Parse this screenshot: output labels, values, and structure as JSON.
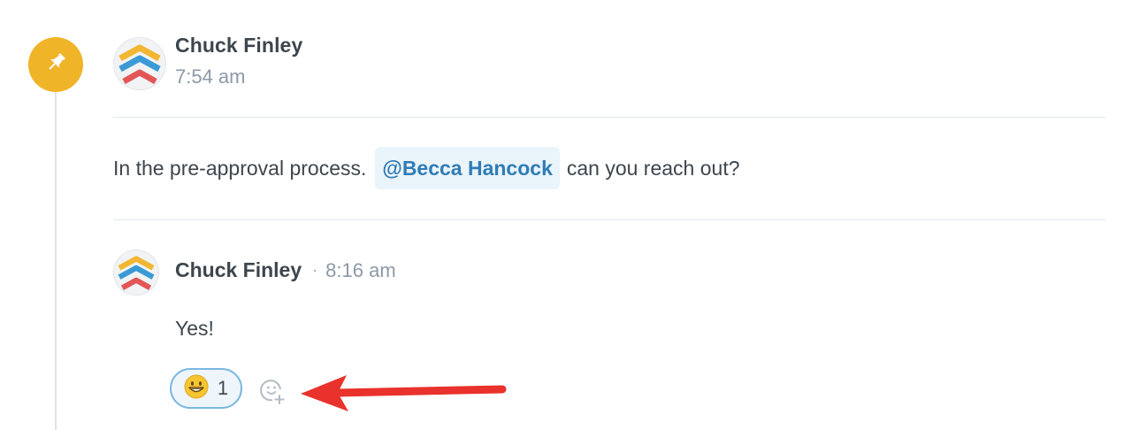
{
  "thread": {
    "author": "Chuck Finley",
    "time": "7:54 am",
    "message_before": "In the pre-approval process.",
    "mention": "@Becca Hancock",
    "message_after": "can you reach out?"
  },
  "reply": {
    "author": "Chuck Finley",
    "separator": "·",
    "time": "8:16 am",
    "text": "Yes!",
    "reaction_count": "1"
  },
  "icons": {
    "pin": "pin-icon",
    "avatar": "chevron-stack-logo",
    "reaction_emoji": "grinning-face-emoji",
    "add_reaction": "add-reaction-icon",
    "annotation": "red-arrow"
  },
  "colors": {
    "pin_badge": "#f0b429",
    "mention_bg": "#eaf4fb",
    "mention_text": "#2f7cb6",
    "reaction_border": "#7ab8e0",
    "arrow": "#e8322b"
  }
}
